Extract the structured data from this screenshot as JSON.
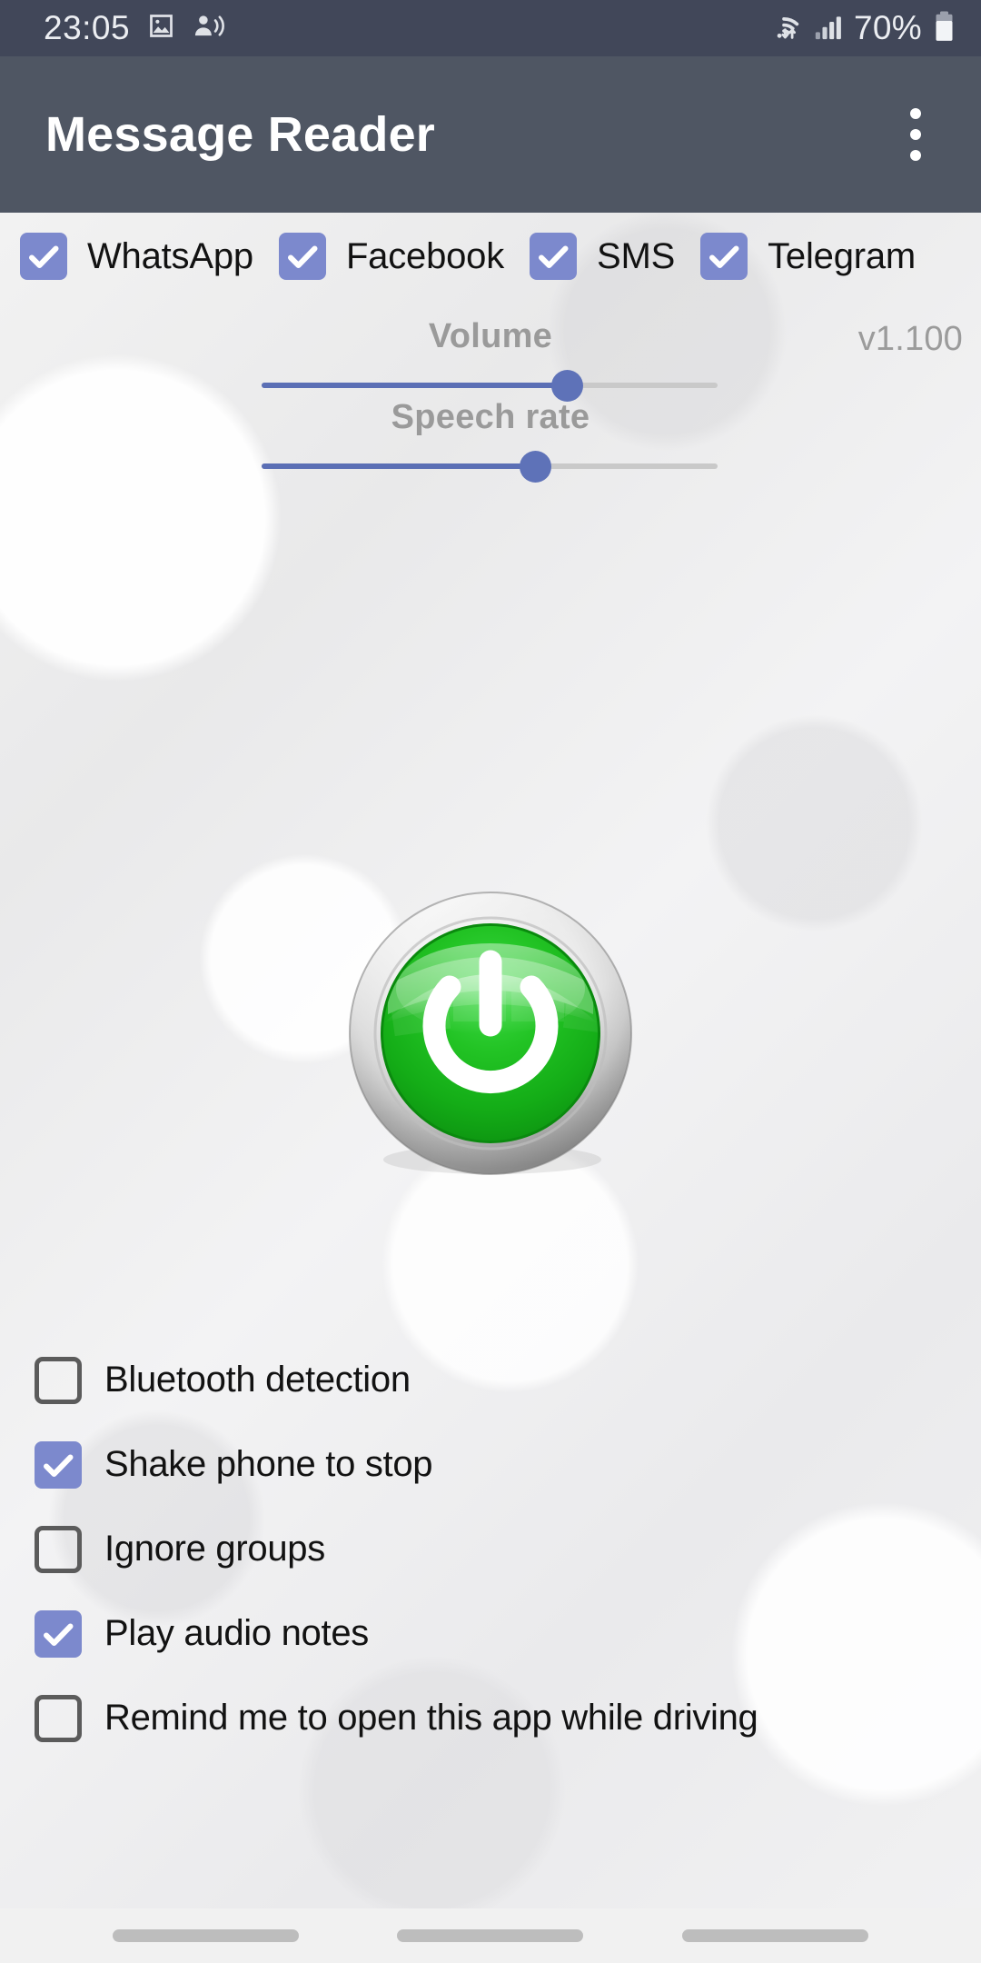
{
  "status_bar": {
    "clock": "23:05",
    "battery_text": "70%",
    "icons": [
      "image-icon",
      "person-audio-icon",
      "wifi-icon",
      "signal-bars-icon",
      "battery-icon"
    ]
  },
  "app_bar": {
    "title": "Message Reader",
    "overflow_label": "overflow-menu"
  },
  "sources": [
    {
      "label": "WhatsApp",
      "checked": true
    },
    {
      "label": "Facebook",
      "checked": true
    },
    {
      "label": "SMS",
      "checked": true
    },
    {
      "label": "Telegram",
      "checked": true
    }
  ],
  "sliders": {
    "volume": {
      "label": "Volume",
      "percent": 67
    },
    "speech_rate": {
      "label": "Speech rate",
      "percent": 60
    }
  },
  "version": "v1.100",
  "power_button": {
    "name": "power-toggle-button",
    "state": "on",
    "color": "#21bd21"
  },
  "options": [
    {
      "label": "Bluetooth detection",
      "checked": false
    },
    {
      "label": "Shake phone to stop",
      "checked": true
    },
    {
      "label": "Ignore groups",
      "checked": false
    },
    {
      "label": "Play audio notes",
      "checked": true
    },
    {
      "label": "Remind me to open this app while driving",
      "checked": false
    }
  ],
  "nav_bar": {
    "items": [
      "recents-pill",
      "home-pill",
      "back-pill"
    ]
  },
  "colors": {
    "status_bar": "#414759",
    "app_bar": "#4f5663",
    "checkbox_checked": "#7c89cd",
    "checkbox_unchecked_border": "#5b5b5b",
    "slider_fill": "#5b6fb5",
    "slider_thumb": "#5e72b8",
    "label_gray": "#9a9a9a",
    "background": "#efeff0"
  }
}
